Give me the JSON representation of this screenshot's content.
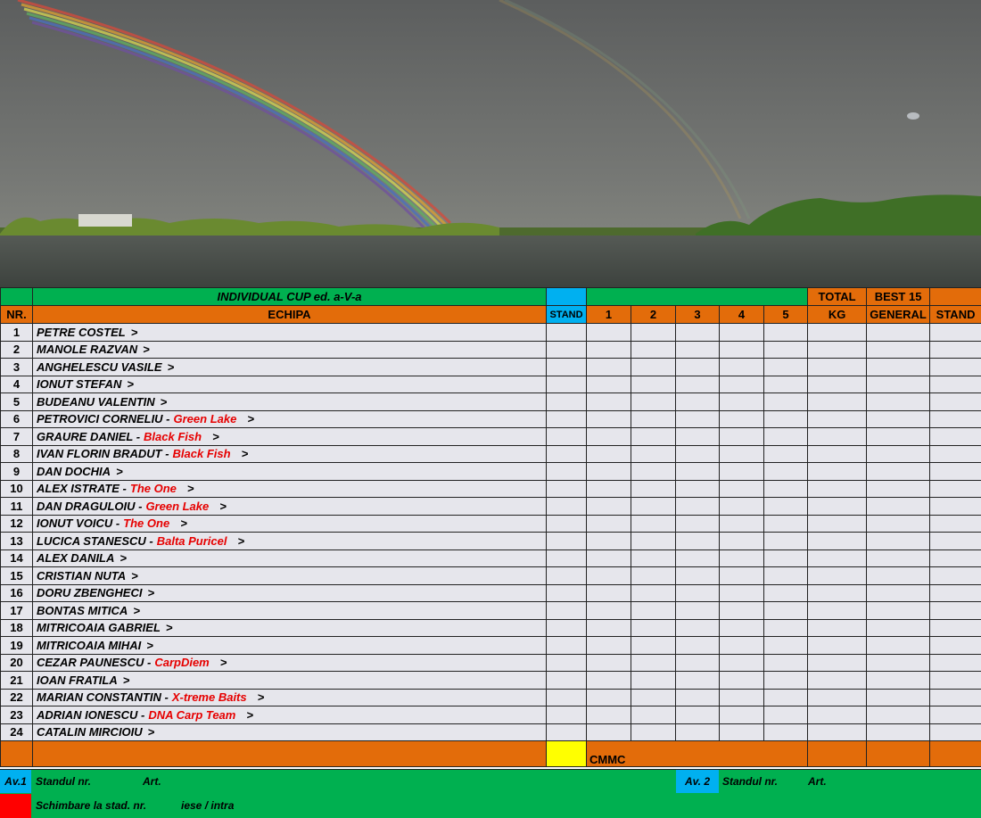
{
  "title": "INDIVIDUAL CUP ed. a-V-a",
  "headers": {
    "nr": "NR.",
    "echipa": "ECHIPA",
    "stand": "STAND",
    "rounds": [
      "1",
      "2",
      "3",
      "4",
      "5"
    ],
    "total_top": "TOTAL",
    "total_bottom": "KG",
    "best_top": "BEST 15",
    "best_bottom": "GENERAL",
    "stand_right": "STAND"
  },
  "rows": [
    {
      "nr": "1",
      "name": "PETRE COSTEL",
      "team": "",
      "arrow": ">"
    },
    {
      "nr": "2",
      "name": "MANOLE RAZVAN",
      "team": "",
      "arrow": ">"
    },
    {
      "nr": "3",
      "name": "ANGHELESCU VASILE",
      "team": "",
      "arrow": ">"
    },
    {
      "nr": "4",
      "name": "IONUT STEFAN",
      "team": "",
      "arrow": ">"
    },
    {
      "nr": "5",
      "name": "BUDEANU VALENTIN",
      "team": "",
      "arrow": ">"
    },
    {
      "nr": "6",
      "name": "PETROVICI CORNELIU -",
      "team": "Green Lake",
      "arrow": ">"
    },
    {
      "nr": "7",
      "name": "GRAURE DANIEL -",
      "team": "Black Fish",
      "arrow": ">"
    },
    {
      "nr": "8",
      "name": "IVAN FLORIN BRADUT -",
      "team": "Black Fish",
      "arrow": ">"
    },
    {
      "nr": "9",
      "name": "DAN DOCHIA",
      "team": "",
      "arrow": ">"
    },
    {
      "nr": "10",
      "name": "ALEX ISTRATE -",
      "team": "The One",
      "arrow": ">"
    },
    {
      "nr": "11",
      "name": "DAN DRAGULOIU -",
      "team": "Green Lake",
      "arrow": ">"
    },
    {
      "nr": "12",
      "name": "IONUT VOICU -",
      "team": "The One",
      "arrow": ">"
    },
    {
      "nr": "13",
      "name": "LUCICA STANESCU -",
      "team": "Balta Puricel",
      "arrow": ">"
    },
    {
      "nr": "14",
      "name": "ALEX DANILA",
      "team": "",
      "arrow": ">"
    },
    {
      "nr": "15",
      "name": "CRISTIAN NUTA",
      "team": "",
      "arrow": ">"
    },
    {
      "nr": "16",
      "name": "DORU ZBENGHECI",
      "team": "",
      "arrow": ">"
    },
    {
      "nr": "17",
      "name": "BONTAS MITICA",
      "team": "",
      "arrow": ">"
    },
    {
      "nr": "18",
      "name": "MITRICOAIA GABRIEL",
      "team": "",
      "arrow": ">"
    },
    {
      "nr": "19",
      "name": "MITRICOAIA MIHAI",
      "team": "",
      "arrow": ">"
    },
    {
      "nr": "20",
      "name": "CEZAR PAUNESCU -",
      "team": "CarpDiem",
      "arrow": ">"
    },
    {
      "nr": "21",
      "name": "IOAN FRATILA",
      "team": "",
      "arrow": ">"
    },
    {
      "nr": "22",
      "name": "MARIAN CONSTANTIN -",
      "team": "X-treme Baits",
      "arrow": ">"
    },
    {
      "nr": "23",
      "name": "ADRIAN IONESCU -",
      "team": "DNA Carp Team",
      "arrow": ">"
    },
    {
      "nr": "24",
      "name": "CATALIN MIRCIOIU",
      "team": "",
      "arrow": ">"
    }
  ],
  "summary": {
    "cmmc": "CMMC"
  },
  "footer": {
    "av1": "Av.1",
    "standul1": "Standul nr.",
    "art1": "Art.",
    "av2": "Av. 2",
    "standul2": "Standul  nr.",
    "art2": "Art.",
    "schimbare": "Schimbare la stad.  nr.",
    "iese": "iese / intra"
  },
  "colors": {
    "green": "#00b050",
    "orange": "#e36c0a",
    "blue": "#00b0f0",
    "yellow": "#ffff00",
    "red": "#ff0000",
    "team_text": "#e60000",
    "row_bg": "#e6e6ec"
  },
  "photo": {
    "subject": "rainbow over lake"
  }
}
